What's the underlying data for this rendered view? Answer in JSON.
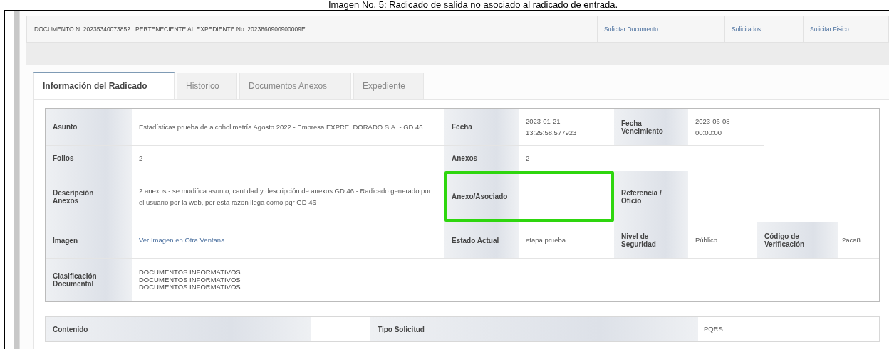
{
  "caption": "Imagen No. 5: Radicado de salida no asociado al radicado de entrada.",
  "header": {
    "document_info": "DOCUMENTO N. 20235340073852   PERTENECIENTE AL EXPEDIENTE No. 2023860900900009E",
    "links": [
      "Solicitar Documento",
      "Solicitados",
      "Solicitar Fisico"
    ]
  },
  "tabs": [
    {
      "label": "Información del Radicado",
      "selected": true
    },
    {
      "label": "Historico",
      "selected": false
    },
    {
      "label": "Documentos Anexos",
      "selected": false
    },
    {
      "label": "Expediente",
      "selected": false
    }
  ],
  "rows": [
    [
      {
        "label": "Asunto",
        "value": "Estadísticas prueba de alcoholimetría Agosto 2022 - Empresa EXPRELDORADO S.A. - GD 46",
        "highlighted": false
      },
      {
        "label": "Fecha",
        "value": "2023-01-21 13:25:58.577923",
        "highlighted": false
      },
      {
        "label": "Fecha Vencimiento",
        "value": "2023-06-08 00:00:00",
        "highlighted": false
      }
    ],
    [
      {
        "label": "Folios",
        "value": "2",
        "highlighted": false
      },
      {
        "label": "Anexos",
        "value": "2",
        "highlighted": false
      }
    ],
    [
      {
        "label": "Descripción Anexos",
        "value": "2 anexos - se modifica asunto, cantidad y descripción de anexos GD 46 - Radicado generado por el usuario por la web, por esta razon llega como pqr GD 46",
        "highlighted": false
      },
      {
        "label": "Anexo/Asociado",
        "highlighted": true
      },
      {
        "label": "Referencia / Oficio",
        "highlighted": false
      }
    ],
    [
      {
        "label": "Imagen",
        "value": "Ver Imagen en Otra Ventana",
        "kind": "link",
        "highlighted": false
      },
      {
        "label": "Estado Actual",
        "value": "etapa prueba",
        "highlighted": false
      },
      {
        "label": "Nivel de Seguridad",
        "value": "Público",
        "highlighted": false
      },
      {
        "label": "Código de Verificación",
        "value": "2aca8",
        "highlighted": false
      }
    ],
    [
      {
        "label": "Clasificación Documental",
        "lines": [
          "DOCUMENTOS INFORMATIVOS",
          "DOCUMENTOS INFORMATIVOS",
          "DOCUMENTOS INFORMATIVOS"
        ],
        "highlighted": false
      }
    ]
  ],
  "content_row": [
    {
      "label": "Contenido"
    },
    {
      "label": "Tipo Solicitud",
      "value": "PQRS"
    }
  ]
}
